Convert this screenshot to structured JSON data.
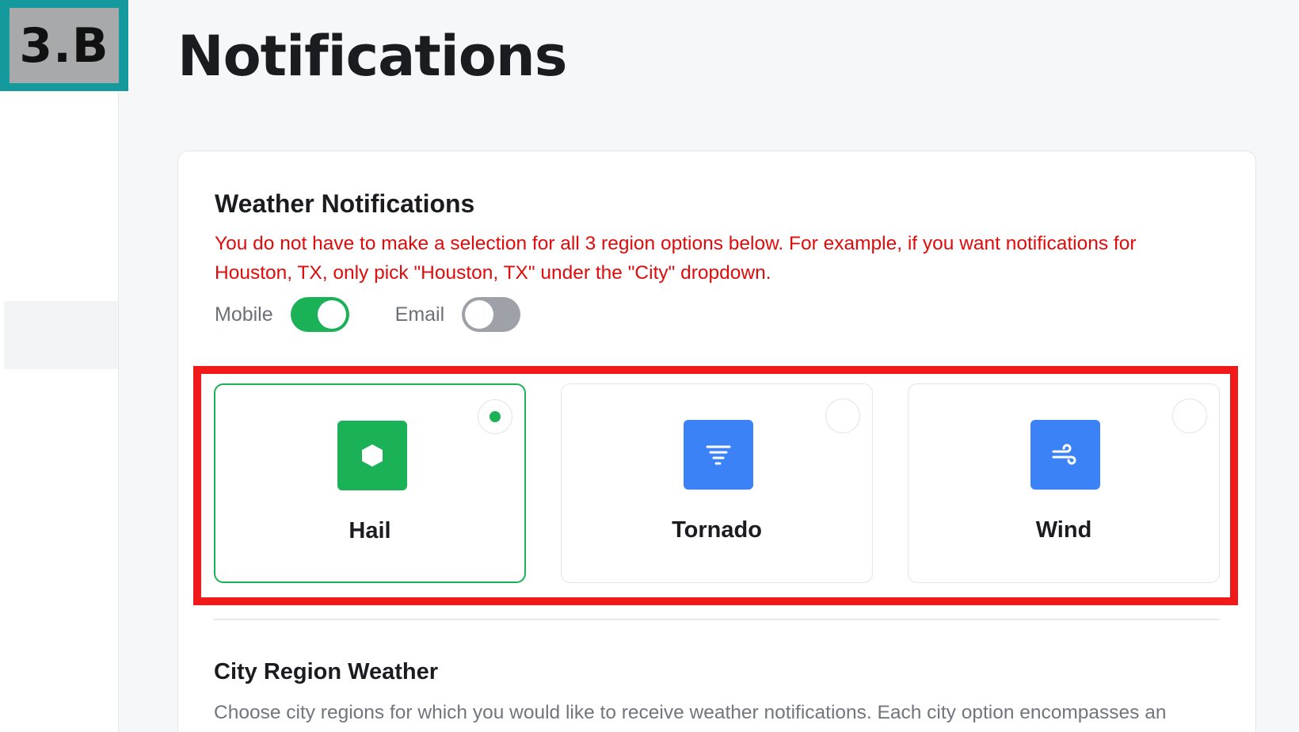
{
  "step_badge": "3.B",
  "page": {
    "title": "Notifications"
  },
  "weather": {
    "title": "Weather Notifications",
    "warning": "You do not have to make a selection for all 3 region options below. For example, if you want notifications for Houston, TX, only pick \"Houston, TX\" under the \"City\" dropdown.",
    "toggles": {
      "mobile": {
        "label": "Mobile",
        "on": true
      },
      "email": {
        "label": "Email",
        "on": false
      }
    },
    "options": [
      {
        "label": "Hail",
        "icon": "hexagon-icon",
        "color": "#1bb157",
        "selected": true
      },
      {
        "label": "Tornado",
        "icon": "tornado-icon",
        "color": "#3b82f6",
        "selected": false
      },
      {
        "label": "Wind",
        "icon": "wind-icon",
        "color": "#3b82f6",
        "selected": false
      }
    ]
  },
  "city_region": {
    "title": "City Region Weather",
    "description": "Choose city regions for which you would like to receive weather notifications. Each city option encompasses an"
  },
  "colors": {
    "accent_green": "#1bb157",
    "icon_blue": "#3b82f6",
    "warning_red": "#e00b0b",
    "annotation_red": "#f01a1a",
    "badge_teal": "#14999c"
  }
}
